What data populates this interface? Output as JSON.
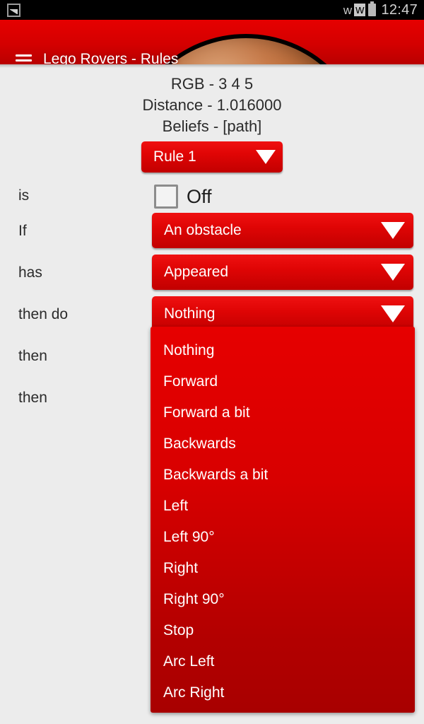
{
  "statusbar": {
    "notification_icon": "image-icon",
    "bluetooth_icon": "bluetooth-icon",
    "bluetooth_connected_icon": "bluetooth-connected-icon",
    "battery_icon": "battery-icon",
    "time": "12:47"
  },
  "appbar": {
    "menu_icon": "hamburger-menu-icon",
    "title": "Lego Rovers - Rules",
    "banner_image": "mars-planet-image",
    "background_color": "#d40000"
  },
  "readouts": {
    "rgb": "RGB - 3 4 5",
    "distance": "Distance - 1.016000",
    "beliefs": "Beliefs - [path]"
  },
  "rule_selector": {
    "value": "Rule 1",
    "caret_icon": "chevron-down-icon"
  },
  "rows": {
    "is": {
      "label": "is",
      "checkbox_checked": false,
      "state_text": "Off"
    },
    "if": {
      "label": "If",
      "value": "An obstacle",
      "caret_icon": "chevron-down-icon"
    },
    "has": {
      "label": "has",
      "value": "Appeared",
      "caret_icon": "chevron-down-icon"
    },
    "then_do": {
      "label": "then do",
      "value": "Nothing",
      "caret_icon": "chevron-down-icon"
    },
    "then_1": {
      "label": "then"
    },
    "then_2": {
      "label": "then"
    }
  },
  "dropdown": {
    "open": true,
    "options": [
      "Nothing",
      "Forward",
      "Forward a bit",
      "Backwards",
      "Backwards a bit",
      "Left",
      "Left 90°",
      "Right",
      "Right 90°",
      "Stop",
      "Arc Left",
      "Arc Right"
    ]
  },
  "colors": {
    "accent_red": "#d40000",
    "dropdown_red": "#d00000",
    "page_background": "#ececec",
    "text_dark": "#2b2b2b"
  }
}
